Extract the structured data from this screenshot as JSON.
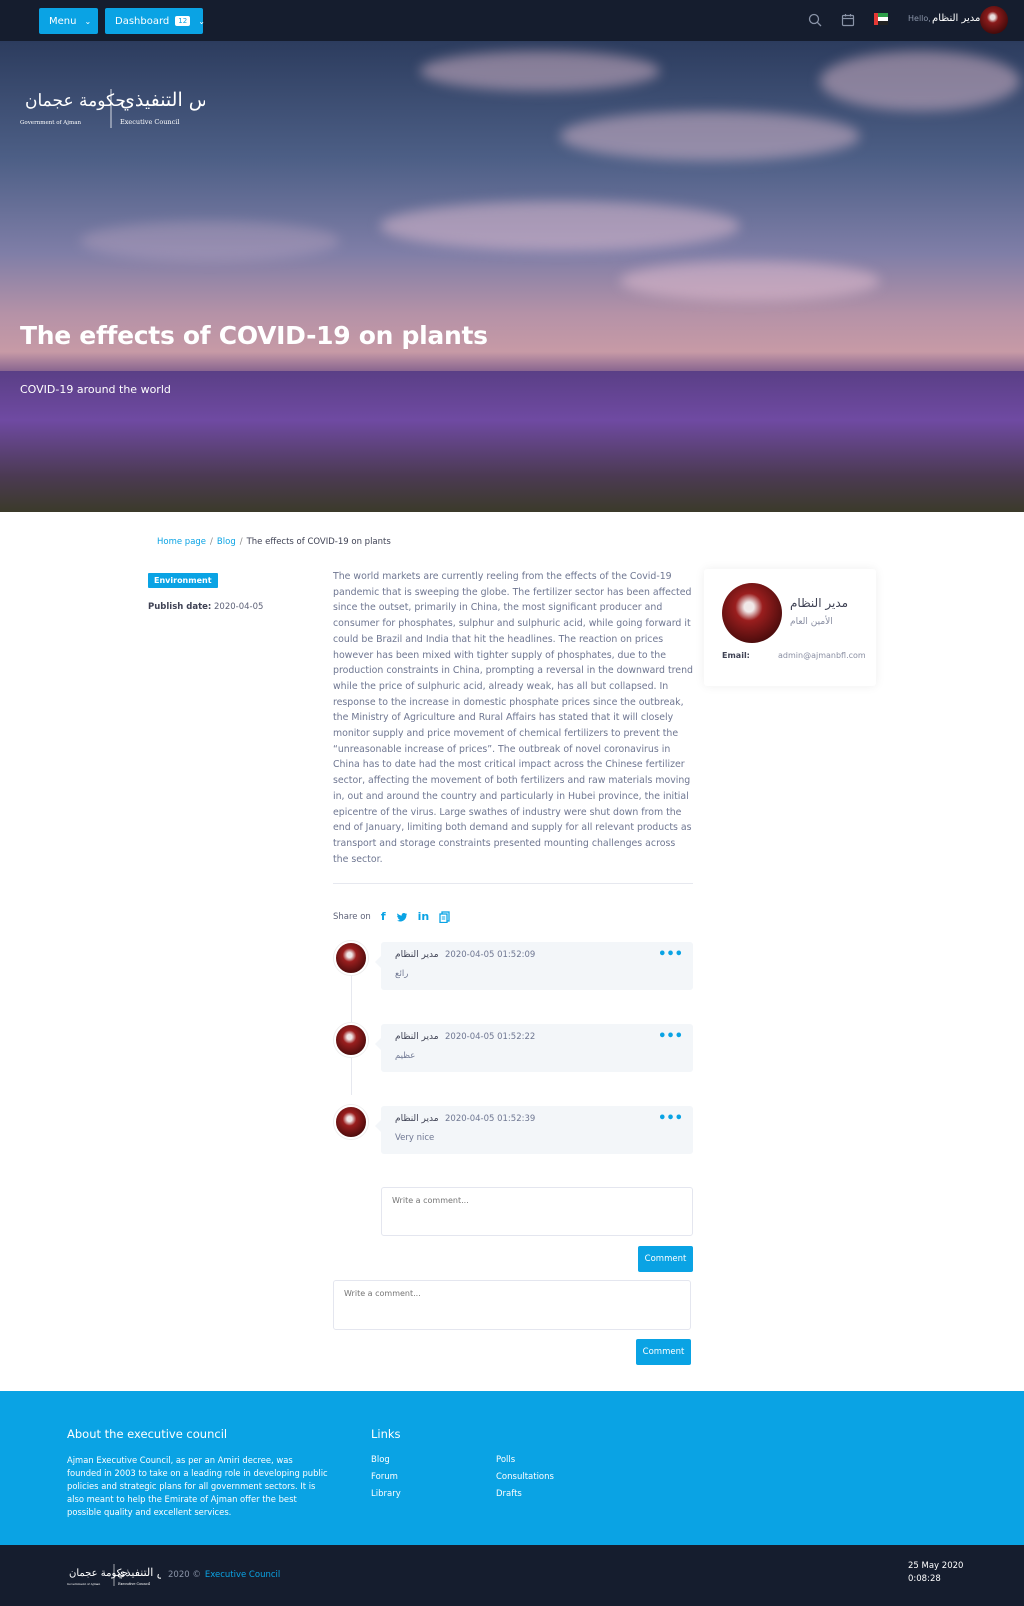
{
  "topbar": {
    "menu_label": "Menu",
    "dashboard_label": "Dashboard",
    "dashboard_badge": "12",
    "hello": "Hello,",
    "user_name": "مدير النظام",
    "icons": [
      "search-icon",
      "calendar-icon",
      "uae-flag-icon"
    ]
  },
  "hero": {
    "logo_right_top": "المجلس التنفيذي",
    "logo_right_bottom": "Executive Council",
    "logo_left_top": "حكومة عجمان",
    "logo_left_bottom": "Government of Ajman",
    "title": "The effects of COVID-19 on plants",
    "subtitle": "COVID-19 around the world"
  },
  "breadcrumb": {
    "home": "Home page",
    "blog": "Blog",
    "current": "The effects of COVID-19 on plants"
  },
  "meta": {
    "category": "Environment",
    "publish_label": "Publish date:",
    "publish_date": "2020-04-05"
  },
  "article": {
    "body": "The world markets are currently reeling from the effects of the Covid-19 pandemic that is sweeping the globe. The fertilizer sector has been affected since the outset, primarily in China, the most significant producer and consumer for phosphates, sulphur and sulphuric acid, while going forward it could be Brazil and India that hit the headlines. The reaction on prices however has been mixed with tighter supply of phosphates, due to the production constraints in China, prompting a reversal in the downward trend while the price of sulphuric acid, already weak, has all but collapsed. In response to the increase in domestic phosphate prices since the outbreak, the Ministry of Agriculture and Rural Affairs has stated that it will closely monitor supply and price movement of chemical fertilizers to prevent the “unreasonable increase of prices”. The outbreak of novel coronavirus in China has to date had the most critical impact across the Chinese fertilizer sector, affecting the movement of both fertilizers and raw materials moving in, out and around the country and particularly in Hubei province, the initial epicentre of the virus. Large swathes of industry were shut down from the end of January, limiting both demand and supply for all relevant products as transport and storage constraints presented mounting challenges across the sector.",
    "share_label": "Share on"
  },
  "author": {
    "name": "مدير النظام",
    "role": "الأمين العام",
    "email_label": "Email:",
    "email": "admin@ajmanbfl.com"
  },
  "comments": [
    {
      "author": "مدير النظام",
      "date": "2020-04-05 01:52:09",
      "text": "رائع"
    },
    {
      "author": "مدير النظام",
      "date": "2020-04-05 01:52:22",
      "text": "عظيم"
    },
    {
      "author": "مدير النظام",
      "date": "2020-04-05 01:52:39",
      "text": "Very nice"
    }
  ],
  "comment_form": {
    "placeholder": "Write a comment...",
    "button": "Comment"
  },
  "footer": {
    "about_title": "About the executive council",
    "about_text": "Ajman Executive Council, as per an Amiri decree, was founded in 2003 to take on a leading role in developing public policies and strategic plans for all government sectors. It is also meant to help the Emirate of Ajman offer the best possible quality and excellent services.",
    "links_title": "Links",
    "links_col1": [
      "Blog",
      "Forum",
      "Library"
    ],
    "links_col2": [
      "Polls",
      "Consultations",
      "Drafts"
    ]
  },
  "bottom": {
    "copyright": "2020 ©",
    "copyright_link": "Executive Council",
    "date": "25 May 2020",
    "time": "0:08:28"
  },
  "colors": {
    "accent": "#0aa3e4",
    "dark": "#151d2e"
  }
}
